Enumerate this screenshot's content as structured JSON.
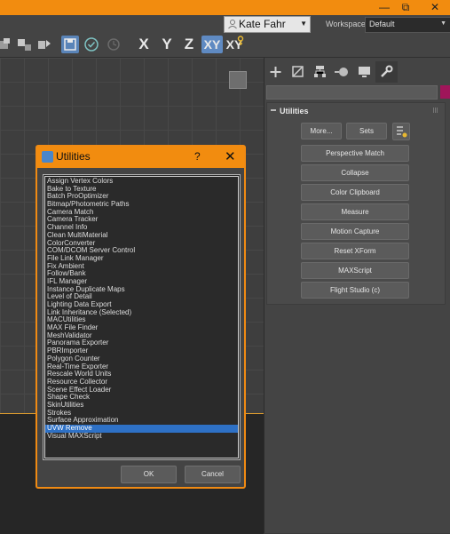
{
  "user": {
    "name": "Kate Fahr"
  },
  "workspaces": {
    "label": "Workspaces:",
    "value": "Default"
  },
  "toolbar": {
    "axes": [
      "X",
      "Y",
      "Z",
      "XY",
      "XY"
    ]
  },
  "command_panel": {
    "rollout_title": "Utilities",
    "more_label": "More...",
    "sets_label": "Sets",
    "buttons": [
      "Perspective Match",
      "Collapse",
      "Color Clipboard",
      "Measure",
      "Motion Capture",
      "Reset XForm",
      "MAXScript",
      "Flight Studio (c)"
    ]
  },
  "dialog": {
    "title": "Utilities",
    "help": "?",
    "close": "✕",
    "ok_label": "OK",
    "cancel_label": "Cancel",
    "selected": "UVW Remove",
    "items": [
      "Assign Vertex Colors",
      "Bake to Texture",
      "Batch ProOptimizer",
      "Bitmap/Photometric Paths",
      "Camera Match",
      "Camera Tracker",
      "Channel Info",
      "Clean MultiMaterial",
      "ColorConverter",
      "COM/DCOM Server Control",
      "File Link Manager",
      "Fix Ambient",
      "Follow/Bank",
      "IFL Manager",
      "Instance Duplicate Maps",
      "Level of Detail",
      "Lighting Data Export",
      "Link Inheritance (Selected)",
      "MACUtilities",
      "MAX File Finder",
      "MeshValidator",
      "Panorama Exporter",
      "PBRImporter",
      "Polygon Counter",
      "Real-Time Exporter",
      "Rescale World Units",
      "Resource Collector",
      "Scene Effect Loader",
      "Shape Check",
      "SkinUtilities",
      "Strokes",
      "Surface Approximation",
      "UVW Remove",
      "Visual MAXScript"
    ]
  },
  "colors": {
    "accent": "#f28c0f",
    "selection": "#2e71c6",
    "panel": "#444444"
  }
}
